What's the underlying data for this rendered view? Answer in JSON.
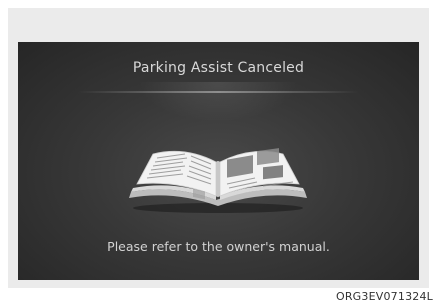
{
  "screen": {
    "title": "Parking Assist Canceled",
    "message": "Please refer to the owner's manual.",
    "icon": "open-book-icon"
  },
  "figure_code": "ORG3EV071324L",
  "colors": {
    "screen_background": "#383838",
    "panel_background": "#ebebeb",
    "text": "#d8d8d8"
  }
}
